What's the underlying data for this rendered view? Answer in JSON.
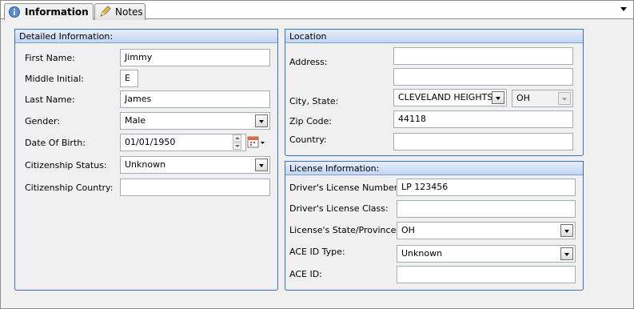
{
  "tabs": [
    {
      "label": "Information",
      "icon": "info-icon",
      "active": true
    },
    {
      "label": "Notes",
      "icon": "pencil-icon",
      "active": false
    }
  ],
  "tab_menu_icon": "chevron-down-icon",
  "detailed": {
    "title": "Detailed Information:",
    "first_name": {
      "label": "First Name:",
      "value": "Jimmy"
    },
    "middle_initial": {
      "label": "Middle Initial:",
      "value": "E"
    },
    "last_name": {
      "label": "Last Name:",
      "value": "James"
    },
    "gender": {
      "label": "Gender:",
      "value": "Male"
    },
    "dob": {
      "label": "Date Of Birth:",
      "value": "01/01/1950"
    },
    "citizenship_status": {
      "label": "Citizenship Status:",
      "value": "Unknown"
    },
    "citizenship_country": {
      "label": "Citizenship Country:",
      "value": ""
    }
  },
  "location": {
    "title": "Location",
    "address": {
      "label": "Address:",
      "line1": "",
      "line2": ""
    },
    "city_state": {
      "label": "City, State:",
      "city": "CLEVELAND HEIGHTS,",
      "state": "OH"
    },
    "zip": {
      "label": "Zip Code:",
      "value": "44118"
    },
    "country": {
      "label": "Country:",
      "value": ""
    }
  },
  "license": {
    "title": "License Information:",
    "number": {
      "label": "Driver's License Number:",
      "value": "LP 123456"
    },
    "class": {
      "label": "Driver's License Class:",
      "value": ""
    },
    "state": {
      "label": "License's State/Province:",
      "value": "OH"
    },
    "ace_type": {
      "label": "ACE ID Type:",
      "value": "Unknown"
    },
    "ace_id": {
      "label": "ACE ID:",
      "value": ""
    }
  },
  "colors": {
    "panel_border": "#3f6fbf",
    "header_gradient_top": "#e6eefb",
    "header_gradient_bottom": "#c2d5f2",
    "background": "#f0f0f0"
  }
}
